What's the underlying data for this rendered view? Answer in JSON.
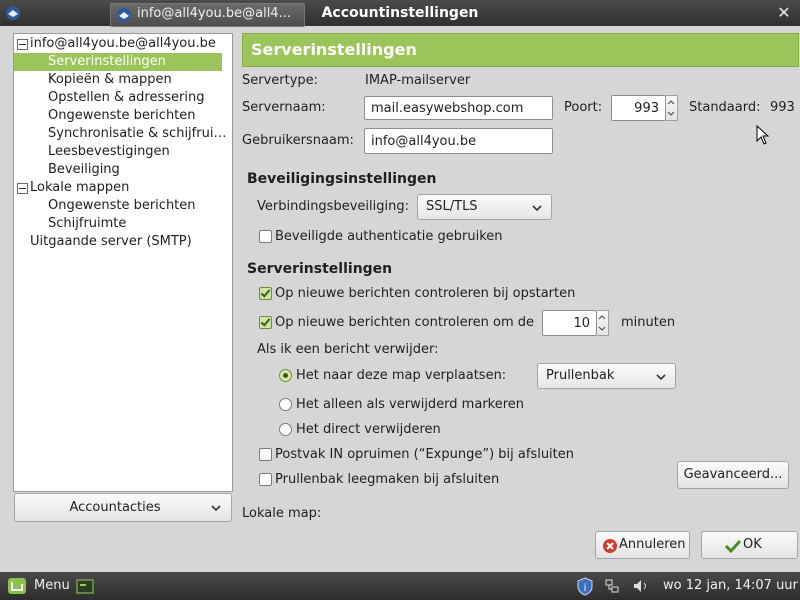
{
  "window": {
    "title": "Accountinstellingen"
  },
  "sidebar": {
    "items": [
      {
        "label": "info@all4you.be@all4you.be",
        "level": 0,
        "expander": true
      },
      {
        "label": "Serverinstellingen",
        "level": 1,
        "selected": true
      },
      {
        "label": "Kopieën & mappen",
        "level": 1
      },
      {
        "label": "Opstellen & adressering",
        "level": 1
      },
      {
        "label": "Ongewenste berichten",
        "level": 1
      },
      {
        "label": "Synchronisatie & schijfrui…",
        "level": 1
      },
      {
        "label": "Leesbevestigingen",
        "level": 1
      },
      {
        "label": "Beveiliging",
        "level": 1
      },
      {
        "label": "Lokale mappen",
        "level": 0,
        "expander": true
      },
      {
        "label": "Ongewenste berichten",
        "level": 1
      },
      {
        "label": "Schijfruimte",
        "level": 1
      },
      {
        "label": "Uitgaande server (SMTP)",
        "level": 0
      }
    ],
    "account_actions": "Accountacties"
  },
  "main": {
    "header": "Serverinstellingen",
    "server_type_label": "Servertype:",
    "server_type_value": "IMAP-mailserver",
    "server_name_label": "Servernaam:",
    "server_name_value": "mail.easywebshop.com",
    "port_label": "Poort:",
    "port_value": "993",
    "default_label": "Standaard:",
    "default_value": "993",
    "username_label": "Gebruikersnaam:",
    "username_value": "info@all4you.be",
    "security_heading": "Beveiligingsinstellingen",
    "connection_security_label": "Verbindingsbeveiliging:",
    "connection_security_value": "SSL/TLS",
    "secure_auth_label": "Beveiligde authenticatie gebruiken",
    "server_heading": "Serverinstellingen",
    "check_startup_label": "Op nieuwe berichten controleren bij opstarten",
    "check_every_label": "Op nieuwe berichten controleren om de",
    "check_every_value": "10",
    "minutes_label": "minuten",
    "delete_label": "Als ik een bericht verwijder:",
    "move_label": "Het naar deze map verplaatsen:",
    "move_folder": "Prullenbak",
    "mark_label": "Het alleen als verwijderd markeren",
    "delete_direct_label": "Het direct verwijderen",
    "expunge_label": "Postvak IN opruimen (“Expunge”) bij afsluiten",
    "empty_trash_label": "Prullenbak leegmaken bij afsluiten",
    "advanced_button": "Geavanceerd...",
    "local_folder_label": "Lokale map:",
    "cancel_button": "Annuleren",
    "ok_button": "OK"
  },
  "taskbar": {
    "menu_label": "Menu",
    "task_label": "info@all4you.be@all4...",
    "clock": "wo 12 jan, 14:07 uur"
  },
  "colors": {
    "accent": "#9bc55b",
    "titlebar": "#3a3a3a",
    "background": "#d6d6d6"
  }
}
